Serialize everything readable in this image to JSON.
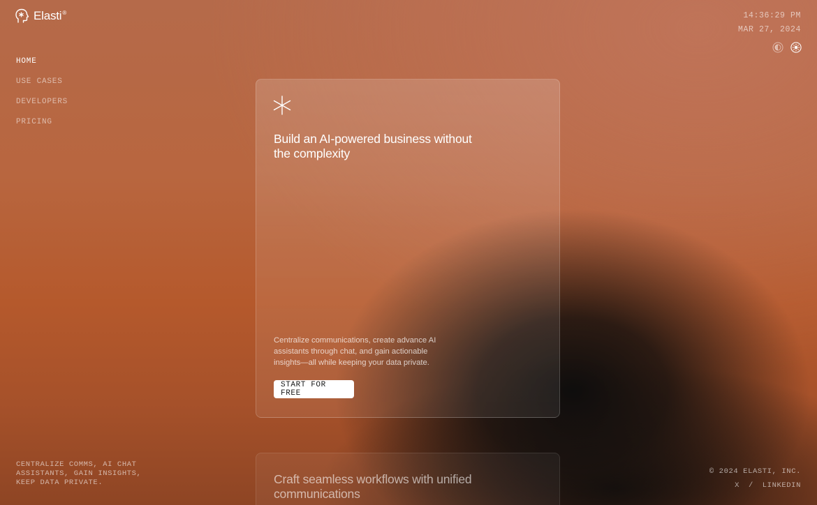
{
  "brand": {
    "name": "Elasti",
    "registered": "®",
    "logo_icon": "head-sparkle-icon"
  },
  "nav": {
    "items": [
      {
        "label": "HOME",
        "active": true
      },
      {
        "label": "USE CASES",
        "active": false
      },
      {
        "label": "DEVELOPERS",
        "active": false
      },
      {
        "label": "PRICING",
        "active": false
      }
    ]
  },
  "clock": {
    "time": "14:36:29 PM",
    "date": "MAR 27, 2024"
  },
  "theme": {
    "options": [
      "contrast-icon",
      "sun-icon"
    ],
    "selected": "sun-icon"
  },
  "hero": {
    "icon": "asterisk-icon",
    "headline": "Build an AI-powered business without the complexity",
    "description": "Centralize communications, create advance AI assistants through chat, and gain actionable insights—all while keeping your data private.",
    "cta_label": "START FOR FREE"
  },
  "next_card": {
    "headline": "Craft seamless workflows with unified communications"
  },
  "footer": {
    "tagline": "CENTRALIZE COMMS, AI CHAT ASSISTANTS, GAIN INSIGHTS, KEEP DATA PRIVATE.",
    "copyright": "© 2024 ELASTI, INC.",
    "link_x": "X",
    "separator": "/",
    "link_linkedin": "LINKEDIN"
  },
  "colors": {
    "background_top": "#b56a4a",
    "background_bottom": "#8e4524",
    "cta_background": "#ffffff",
    "cta_text": "#1a1a1a"
  }
}
